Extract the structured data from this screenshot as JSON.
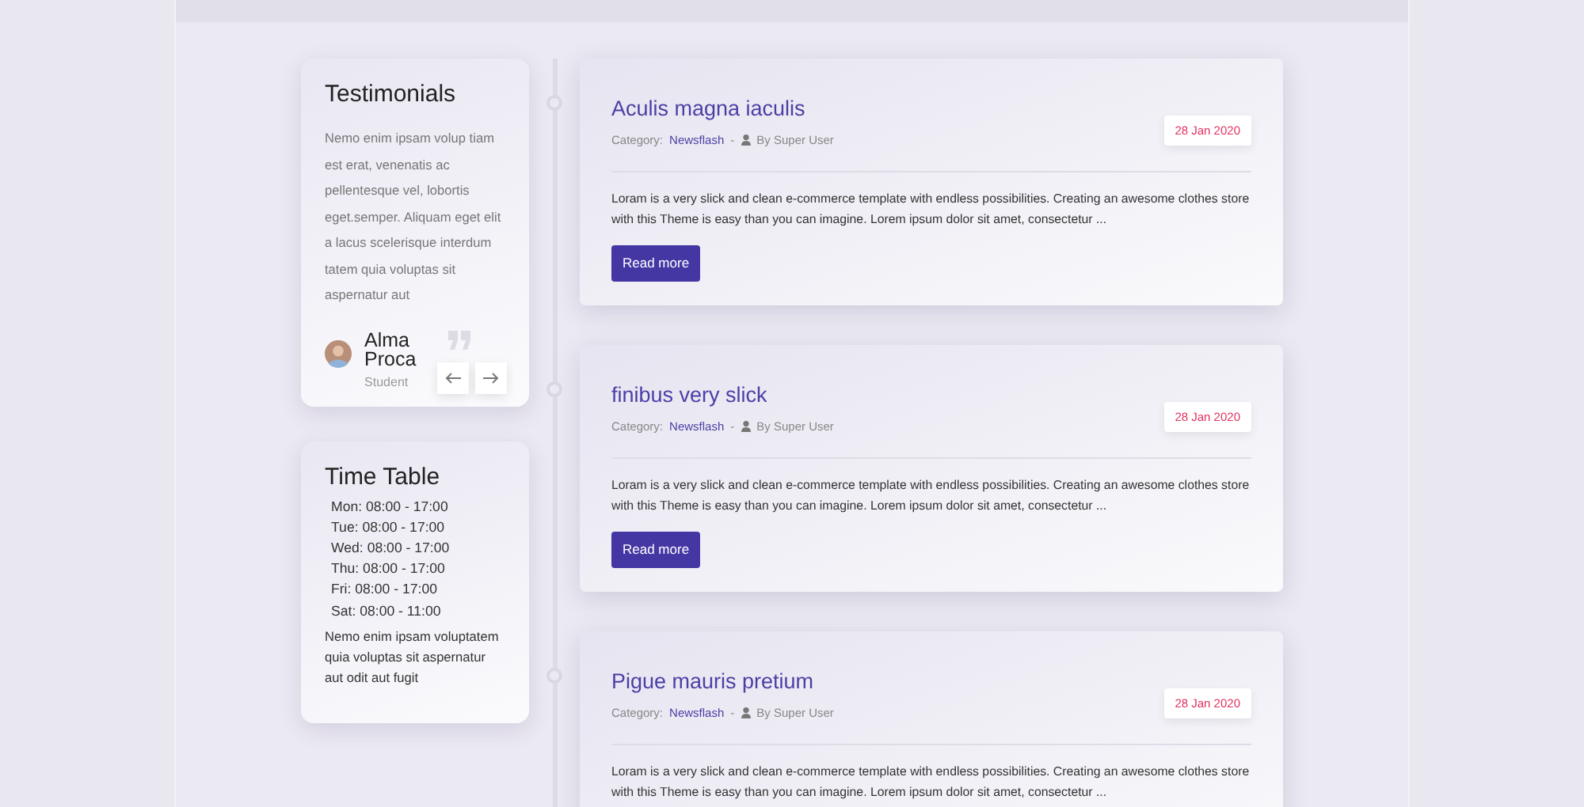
{
  "testimonials": {
    "title": "Testimonials",
    "quote": "Nemo enim ipsam volup tiam est erat, venenatis ac pellentesque vel, lobortis eget.semper. Aliquam eget elit a lacus scelerisque interdum tatem quia voluptas sit aspernatur aut",
    "author": "Alma Proca",
    "role": "Student"
  },
  "time_table": {
    "title": "Time Table",
    "hours": [
      "Mon: 08:00 - 17:00",
      "Tue: 08:00 - 17:00",
      "Wed: 08:00 - 17:00",
      "Thu: 08:00 - 17:00",
      "Fri: 08:00 - 17:00",
      "Sat: 08:00 - 11:00"
    ],
    "note": "Nemo enim ipsam voluptatem quia voluptas sit aspernatur aut odit aut fugit"
  },
  "posts": [
    {
      "title": "Aculis magna iaculis",
      "category_label": "Category:",
      "category": "Newsflash",
      "separator": "-",
      "author": "By Super User",
      "date": "28 Jan 2020",
      "excerpt": "Loram is a very slick and clean e-commerce template with endless possibilities. Creating an awesome clothes store with this Theme is easy than you can imagine. Lorem ipsum dolor sit amet, consectetur ...",
      "button": "Read more"
    },
    {
      "title": "finibus very slick",
      "category_label": "Category:",
      "category": "Newsflash",
      "separator": "-",
      "author": "By Super User",
      "date": "28 Jan 2020",
      "excerpt": "Loram is a very slick and clean e-commerce template with endless possibilities. Creating an awesome clothes store with this Theme is easy than you can imagine. Lorem ipsum dolor sit amet, consectetur ...",
      "button": "Read more"
    },
    {
      "title": "Pigue mauris pretium",
      "category_label": "Category:",
      "category": "Newsflash",
      "separator": "-",
      "author": "By Super User",
      "date": "28 Jan 2020",
      "excerpt": "Loram is a very slick and clean e-commerce template with endless possibilities. Creating an awesome clothes store with this Theme is easy than you can imagine. Lorem ipsum dolor sit amet, consectetur ..."
    }
  ]
}
